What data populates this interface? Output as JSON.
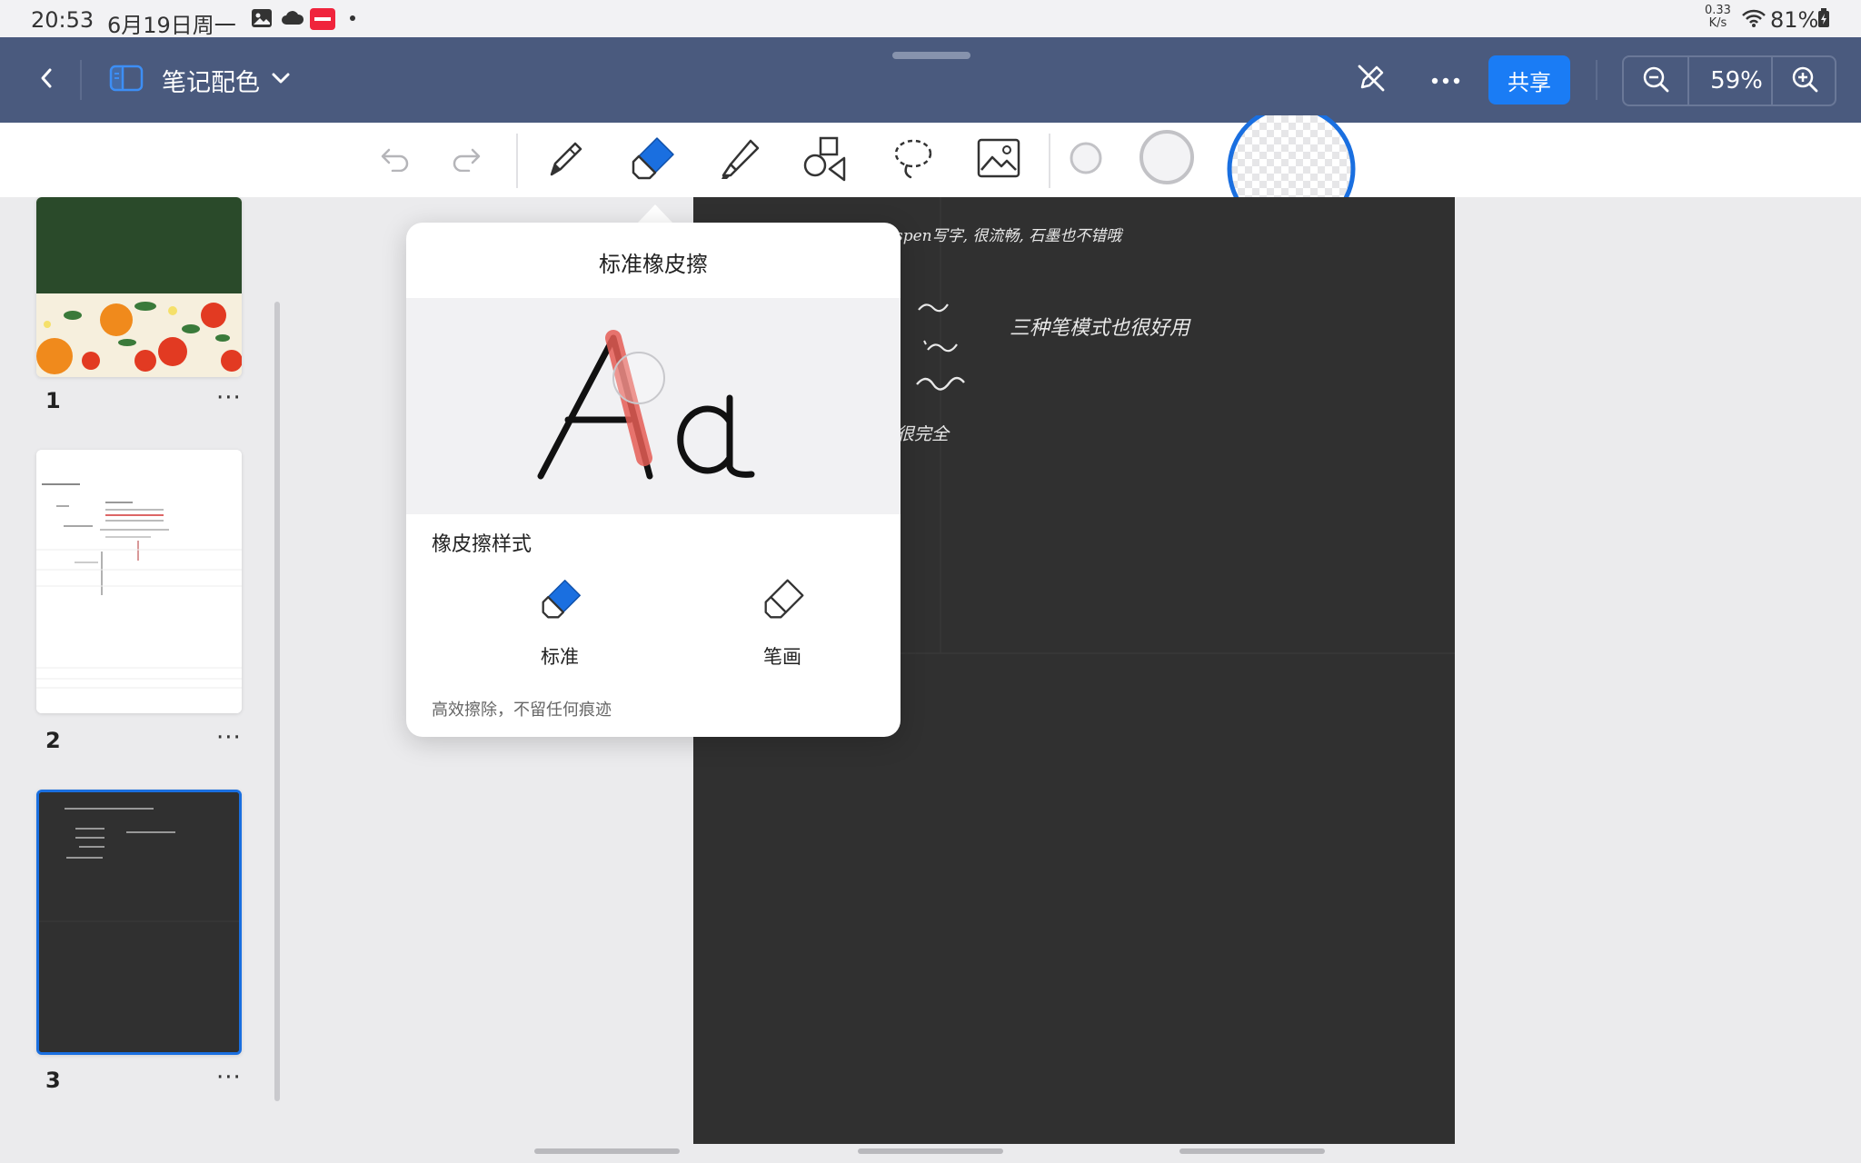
{
  "status_bar": {
    "time": "20:53",
    "date": "6月19日周一",
    "net_speed_value": "0.33",
    "net_speed_unit": "K/s",
    "battery": "81%",
    "icons": [
      "gallery-icon",
      "cloud-icon",
      "xiaohongshu-icon",
      "dot-icon",
      "wifi-icon",
      "battery-icon"
    ]
  },
  "title_bar": {
    "doc_title": "笔记配色",
    "share_label": "共享",
    "zoom_level": "59%",
    "icons": [
      "back-icon",
      "sidebar-toggle-icon",
      "chevron-down-icon",
      "pencil-off-icon",
      "more-icon",
      "zoom-out-icon",
      "zoom-in-icon"
    ]
  },
  "toolbar": {
    "tools": [
      "undo",
      "redo",
      "pen",
      "eraser",
      "highlighter",
      "shapes",
      "lasso",
      "image"
    ],
    "selected_tool": "eraser",
    "accent_color": "#1a6fe0"
  },
  "sidebar": {
    "pages": [
      {
        "number": "1",
        "more": "···"
      },
      {
        "number": "2",
        "more": "···"
      },
      {
        "number": "3",
        "more": "···"
      }
    ],
    "selected_page": "3"
  },
  "note": {
    "lines": [
      "spen写字, 很流畅, 石墨也不错哦",
      "三种笔模式也很好用",
      "很完全"
    ],
    "page_color": "#303030"
  },
  "eraser_popover": {
    "title": "标准橡皮擦",
    "preview_text": "Aa",
    "style_label": "橡皮擦样式",
    "options": [
      {
        "label": "标准",
        "selected": true
      },
      {
        "label": "笔画",
        "selected": false
      }
    ],
    "description": "高效擦除，不留任何痕迹"
  }
}
